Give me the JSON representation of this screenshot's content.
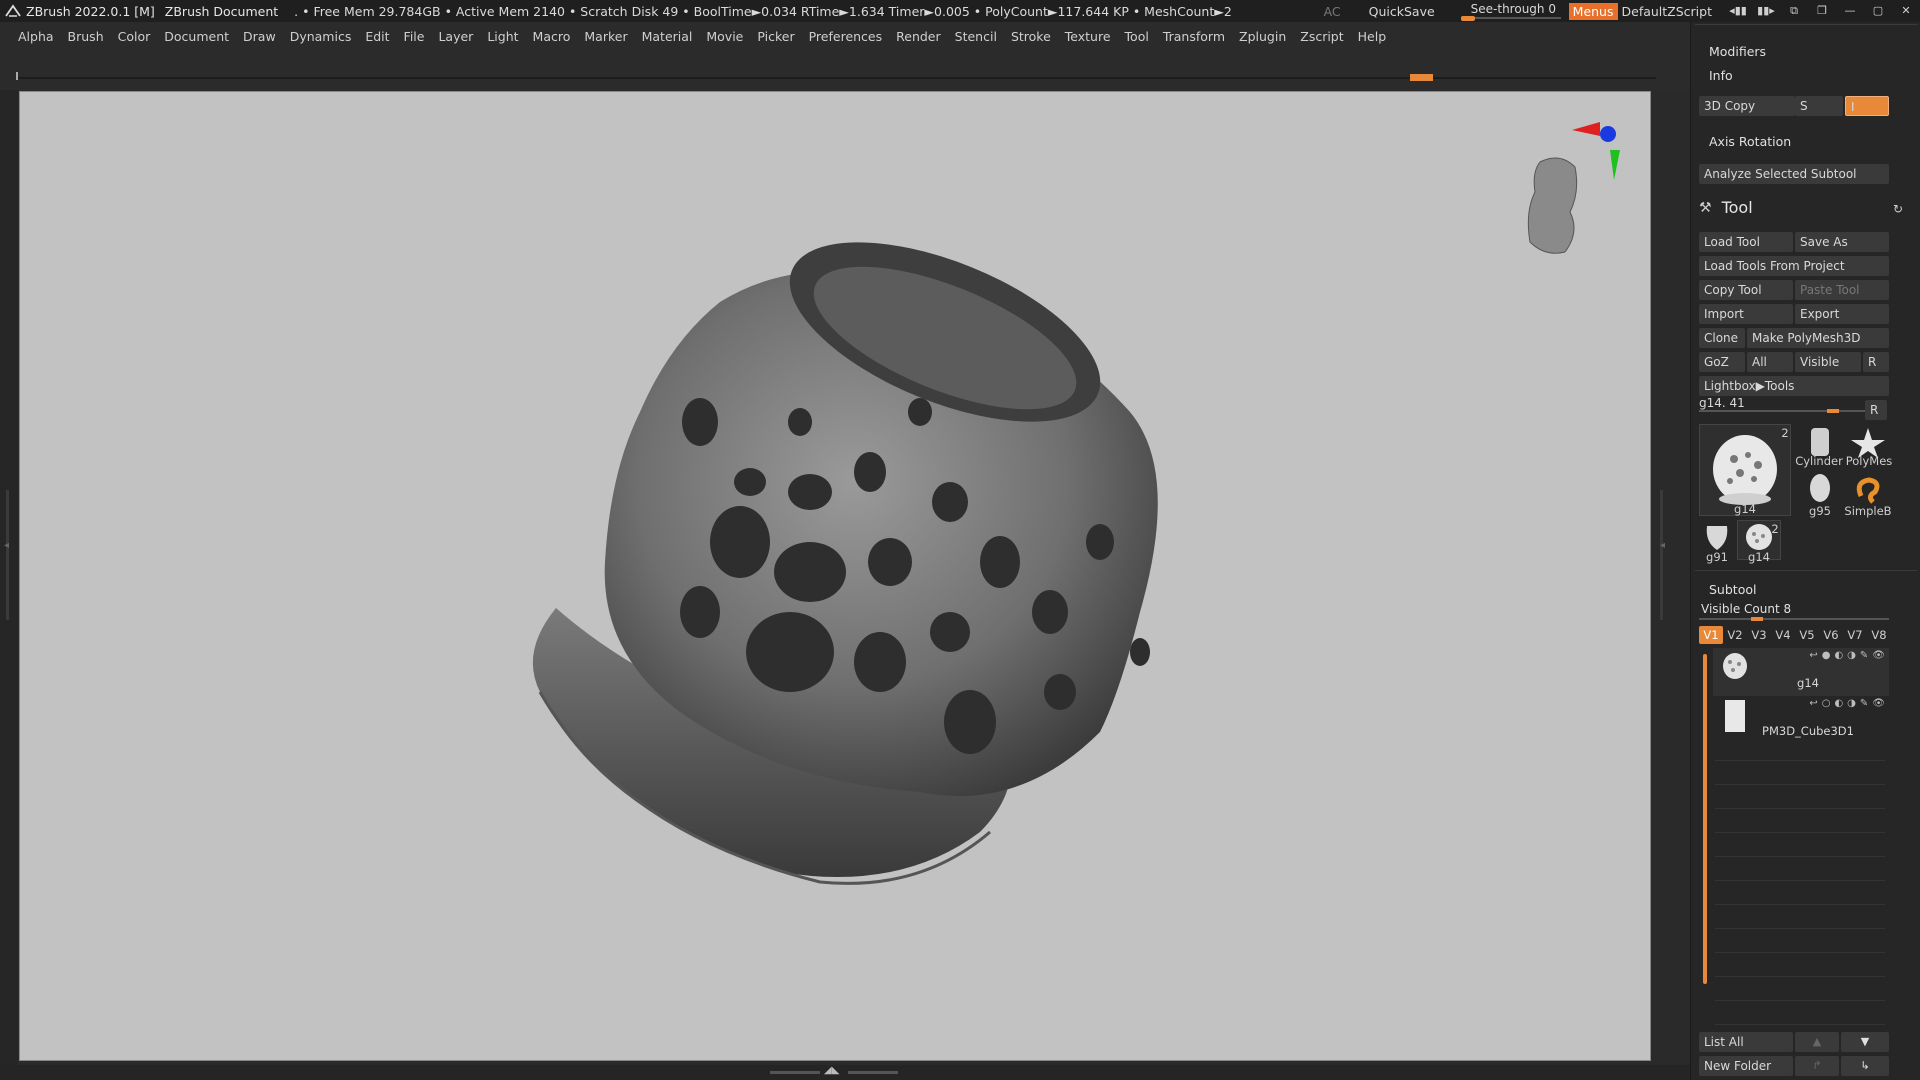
{
  "titlebar": {
    "app": "ZBrush 2022.0.1 [M]",
    "document": "ZBrush Document",
    "stats": ". • Free Mem 29.784GB • Active Mem 2140 • Scratch Disk 49 •  BoolTime►0.034 RTime►1.634 Timer►0.005 • PolyCount►117.644 KP  • MeshCount►2",
    "ac": "AC",
    "quicksave": "QuickSave",
    "see_through": "See-through  0",
    "menus": "Menus",
    "script": "DefaultZScript"
  },
  "menubar": [
    "Alpha",
    "Brush",
    "Color",
    "Document",
    "Draw",
    "Dynamics",
    "Edit",
    "File",
    "Layer",
    "Light",
    "Macro",
    "Marker",
    "Material",
    "Movie",
    "Picker",
    "Preferences",
    "Render",
    "Stencil",
    "Stroke",
    "Texture",
    "Tool",
    "Transform",
    "Zplugin",
    "Zscript",
    "Help"
  ],
  "right_panel": {
    "modifiers": "Modifiers",
    "info": "Info",
    "copy3d": "3D Copy",
    "s": "S",
    "i": "I",
    "axis_rotation": "Axis Rotation",
    "analyze": "Analyze Selected Subtool",
    "tool_title": "Tool",
    "load_tool": "Load Tool",
    "save_as": "Save As",
    "load_from_project": "Load Tools From Project",
    "copy_tool": "Copy Tool",
    "paste_tool": "Paste Tool",
    "import": "Import",
    "export": "Export",
    "clone": "Clone",
    "make_polymesh": "Make PolyMesh3D",
    "goz": "GoZ",
    "all": "All",
    "visible": "Visible",
    "r": "R",
    "lightbox_tools": "Lightbox▶Tools",
    "current_tool": "g14. 41",
    "r2": "R",
    "thumbs": {
      "main_count": "2",
      "main_label": "g14",
      "cylinder": "Cylinder",
      "polymesh": "PolyMes",
      "g95": "g95",
      "simpleb": "SimpleB",
      "g91": "g91",
      "g14_small": "g14",
      "g14_small_count": "2"
    },
    "subtool_title": "Subtool",
    "visible_count": "Visible Count 8",
    "vtabs": [
      "V1",
      "V2",
      "V3",
      "V4",
      "V5",
      "V6",
      "V7",
      "V8"
    ],
    "subtools": [
      {
        "name": "g14"
      },
      {
        "name": "PM3D_Cube3D1"
      }
    ],
    "list_all": "List All",
    "new_folder": "New Folder"
  }
}
